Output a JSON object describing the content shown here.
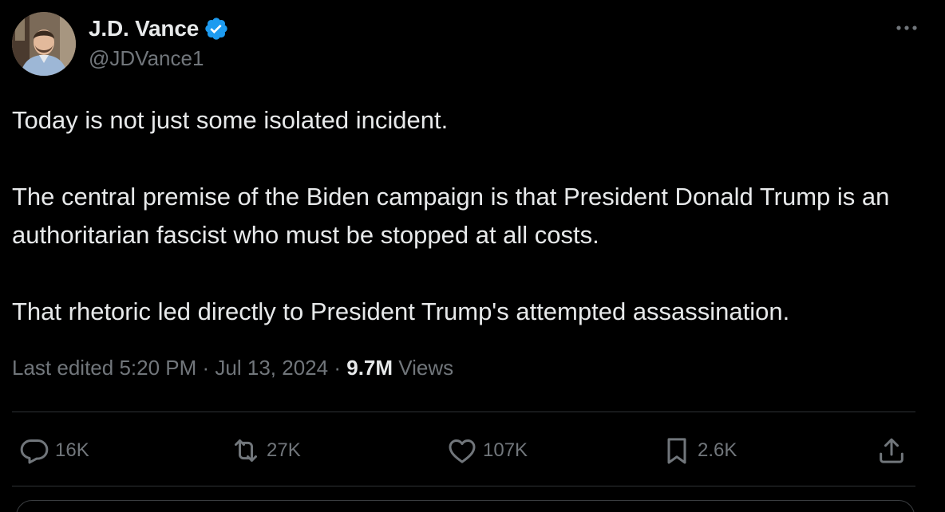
{
  "author": {
    "display_name": "J.D. Vance",
    "handle": "@JDVance1",
    "verified": true,
    "verified_color": "#1d9bf0"
  },
  "tweet": {
    "paragraphs": [
      "Today is not just some isolated incident.",
      "The central premise of the Biden campaign is that President Donald Trump is an authoritarian fascist who must be stopped at all costs.",
      "That rhetoric led directly to President Trump's attempted assassination."
    ]
  },
  "meta": {
    "last_edited_label": "Last edited",
    "time": "5:20 PM",
    "separator": "·",
    "date": "Jul 13, 2024",
    "views_count": "9.7M",
    "views_label": "Views"
  },
  "actions": {
    "reply_count": "16K",
    "retweet_count": "27K",
    "like_count": "107K",
    "bookmark_count": "2.6K"
  },
  "icons": {
    "more": "more-horizontal-icon",
    "reply": "reply-icon",
    "retweet": "retweet-icon",
    "like": "heart-icon",
    "bookmark": "bookmark-icon",
    "share": "share-icon"
  }
}
